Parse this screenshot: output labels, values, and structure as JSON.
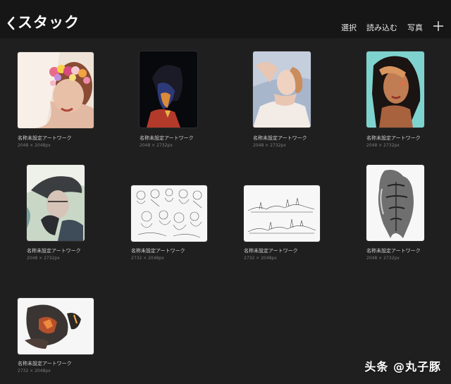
{
  "header": {
    "title": "スタック",
    "actions": {
      "select": "選択",
      "import": "読み込む",
      "photo": "写真"
    }
  },
  "artworks": [
    {
      "name": "名称未設定アートワーク",
      "size": "2048 × 2048px",
      "subject": "flower-crown portrait"
    },
    {
      "name": "名称未設定アートワーク",
      "size": "2048 × 2732px",
      "subject": "dark lit portrait"
    },
    {
      "name": "名称未設定アートワーク",
      "size": "2048 × 2732px",
      "subject": "sunlit woman"
    },
    {
      "name": "名称未設定アートワーク",
      "size": "2048 × 2732px",
      "subject": "hand on head portrait"
    },
    {
      "name": "名称未設定アートワーク",
      "size": "2048 × 2732px",
      "subject": "old woman with hat"
    },
    {
      "name": "名称未設定アートワーク",
      "size": "2732 × 2048px",
      "subject": "figure sketches"
    },
    {
      "name": "名称未設定アートワーク",
      "size": "2732 × 2048px",
      "subject": "landscape sketch"
    },
    {
      "name": "名称未設定アートワーク",
      "size": "2048 × 2732px",
      "subject": "torso anatomy sketch"
    },
    {
      "name": "名称未設定アートワーク",
      "size": "2732 × 2048px",
      "subject": "glowing hands"
    }
  ],
  "watermark": "头条 @丸子豚",
  "colors": {
    "background": "#1f1f1f",
    "topbar": "#161616",
    "text": "#ffffff",
    "muted": "#7d7d7d"
  }
}
